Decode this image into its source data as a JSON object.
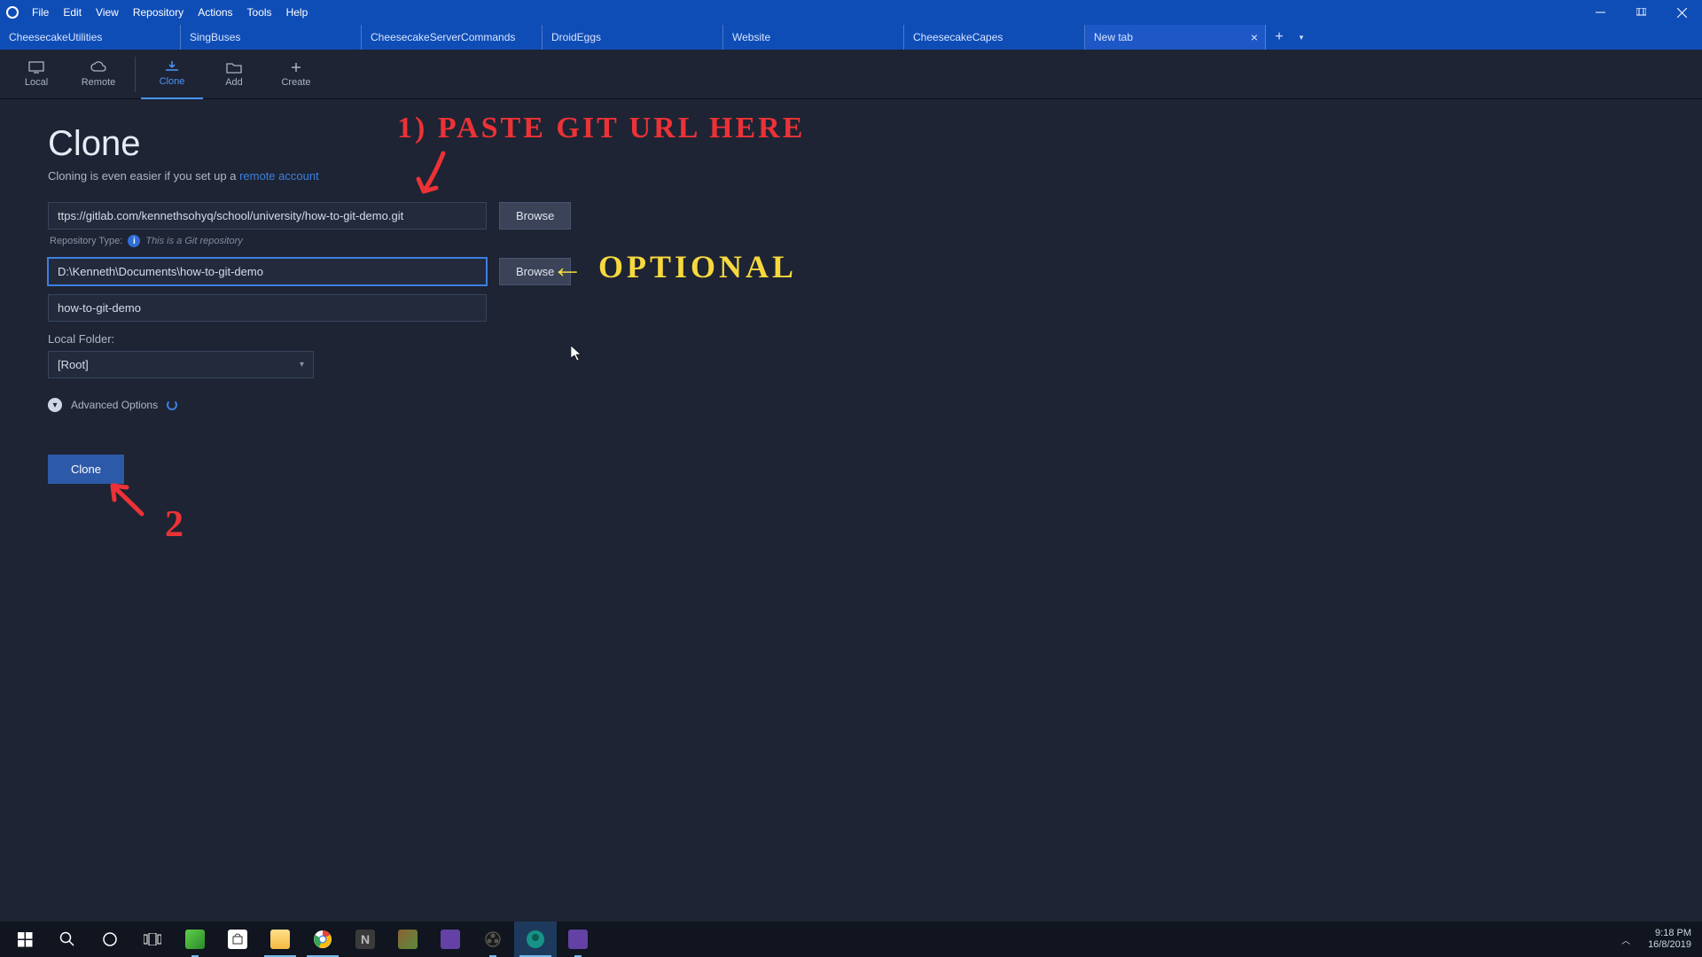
{
  "menubar": {
    "items": [
      "File",
      "Edit",
      "View",
      "Repository",
      "Actions",
      "Tools",
      "Help"
    ]
  },
  "tabs": [
    {
      "label": "CheesecakeUtilities"
    },
    {
      "label": "SingBuses"
    },
    {
      "label": "CheesecakeServerCommands"
    },
    {
      "label": "DroidEggs"
    },
    {
      "label": "Website"
    },
    {
      "label": "CheesecakeCapes"
    },
    {
      "label": "New tab",
      "newtab": true
    }
  ],
  "toolbar": {
    "local": "Local",
    "remote": "Remote",
    "clone": "Clone",
    "add": "Add",
    "create": "Create"
  },
  "clone": {
    "title": "Clone",
    "subtitle_pre": "Cloning is even easier if you set up a ",
    "subtitle_link": "remote account",
    "url_value": "ttps://gitlab.com/kennethsohyq/school/university/how-to-git-demo.git",
    "browse1": "Browse",
    "repo_type_label": "Repository Type:",
    "repo_type_msg": "This is a Git repository",
    "dest_value": "D:\\Kenneth\\Documents\\how-to-git-demo",
    "browse2": "Browse",
    "name_value": "how-to-git-demo",
    "local_folder_label": "Local Folder:",
    "local_folder_value": "[Root]",
    "advanced": "Advanced Options",
    "clone_btn": "Clone"
  },
  "annotations": {
    "a1": "1) PASTE  GIT  URL  HERE",
    "a2": "←  OPTIONAL",
    "a3": "2"
  },
  "taskbar": {
    "time": "9:18 PM",
    "date": "16/8/2019"
  }
}
